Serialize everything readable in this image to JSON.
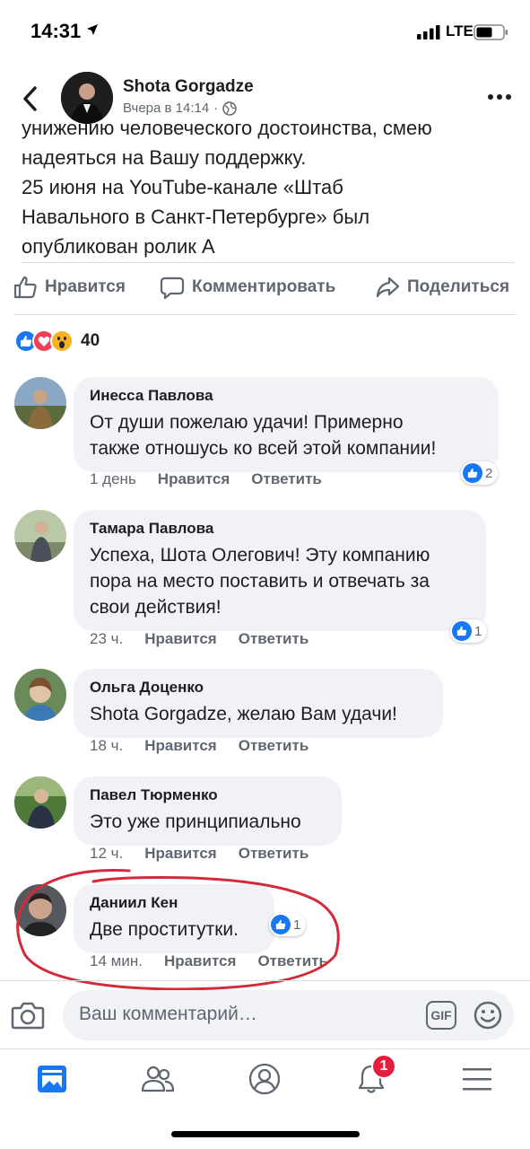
{
  "status_bar": {
    "time": "14:31",
    "network": "LTE"
  },
  "header": {
    "name": "Shota Gorgadze",
    "timestamp": "Вчера в 14:14",
    "separator": "·"
  },
  "post": {
    "lines": [
      "унижению человеческого достоинства, смею",
      "надеяться на Вашу поддержку.",
      "25 июня на YouTube-канале «Штаб",
      "Навального в Санкт-Петербурге» был",
      "опубликован ролик А"
    ]
  },
  "actions": {
    "like": "Нравится",
    "comment": "Комментировать",
    "share": "Поделиться"
  },
  "reactions": {
    "count": "40"
  },
  "comments": [
    {
      "name": "Инесса Павлова",
      "lines": [
        "От души пожелаю удачи! Примерно",
        "также отношусь ко всей этой компании!"
      ],
      "time": "1 день",
      "like": "Нравится",
      "reply": "Ответить",
      "reactions": "2"
    },
    {
      "name": "Тамара Павлова",
      "lines": [
        "Успеха, Шота Олегович! Эту компанию",
        "пора на место поставить и отвечать за",
        "свои действия!"
      ],
      "time": "23 ч.",
      "like": "Нравится",
      "reply": "Ответить",
      "reactions": "1"
    },
    {
      "name": "Ольга Доценко",
      "lines": [
        "Shota Gorgadze, желаю Вам удачи!"
      ],
      "time": "18 ч.",
      "like": "Нравится",
      "reply": "Ответить",
      "reactions": ""
    },
    {
      "name": "Павел Тюрменко",
      "lines": [
        "Это уже принципиально"
      ],
      "time": "12 ч.",
      "like": "Нравится",
      "reply": "Ответить",
      "reactions": ""
    },
    {
      "name": "Даниил Кен",
      "lines": [
        "Две проститутки."
      ],
      "time": "14 мин.",
      "like": "Нравится",
      "reply": "Ответить",
      "reactions": "1"
    }
  ],
  "composer": {
    "placeholder": "Ваш комментарий…",
    "gif": "GIF"
  },
  "nav": {
    "notifications_badge": "1"
  },
  "colors": {
    "accent": "#1877f2",
    "bubble": "#f0f2f5",
    "meta": "#606770",
    "badge": "#e41e3f",
    "annotation": "#d42a3a"
  }
}
